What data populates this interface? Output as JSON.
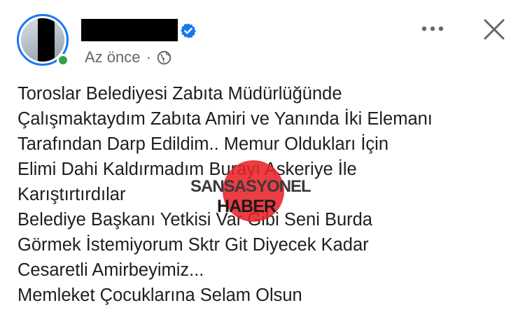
{
  "post": {
    "header": {
      "author_name": "",
      "timestamp": "Az önce",
      "separator": "·",
      "audience_icon": "globe-icon",
      "verified_icon": "verified-badge-icon",
      "more_icon": "more-options-icon",
      "close_icon": "close-icon"
    },
    "lines": [
      "Toroslar Belediyesi Zabıta Müdürlüğünde",
      "Çalışmaktaydım Zabıta Amiri ve Yanında İki Elemanı",
      "Tarafından Darp Edildim.. Memur Oldukları İçin",
      "Elimi Dahi Kaldırmadım Burayı Askeriye İle",
      "Karıştırtırdılar",
      "Belediye Başkanı Yetkisi Var Gibi Seni Burda",
      "Görmek İstemiyorum Sktr Git Diyecek Kadar",
      "Cesaretli Amirbeyimiz...",
      "Memleket Çocuklarına Selam Olsun"
    ]
  },
  "watermark": {
    "line1": "SANSASYONEL",
    "line2": "HABER"
  },
  "colors": {
    "accent": "#1877f2",
    "online": "#31a24c",
    "meta_text": "#65676b",
    "body_text": "#1c1e21",
    "watermark_red": "#e82228"
  }
}
